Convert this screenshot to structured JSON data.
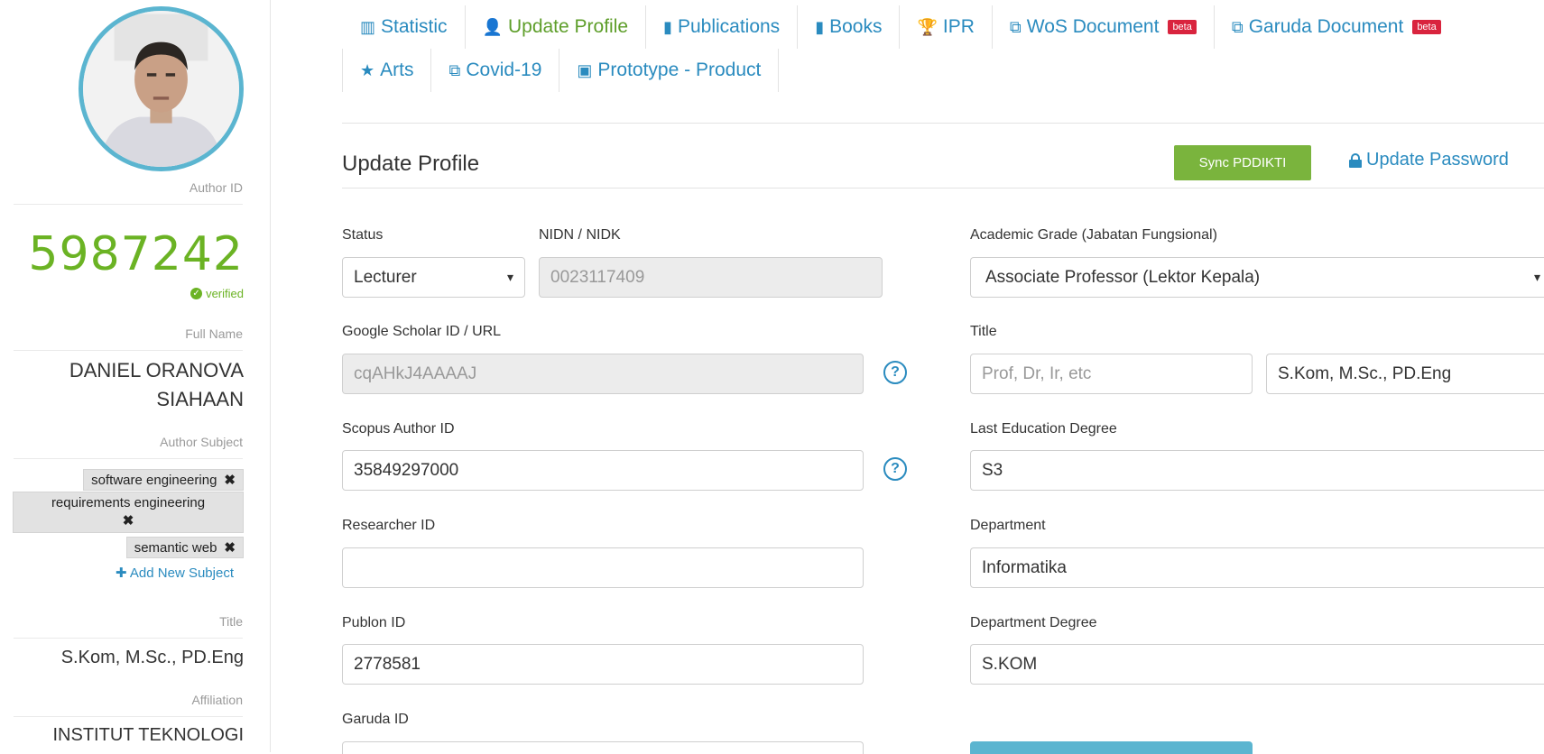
{
  "sidebar": {
    "author_id_label": "Author ID",
    "author_id": "5987242",
    "verified": "verified",
    "full_name_label": "Full Name",
    "full_name": "DANIEL ORANOVA SIAHAAN",
    "subject_label": "Author Subject",
    "subjects": [
      "software engineering",
      "requirements engineering",
      "semantic web"
    ],
    "add_subject": "Add New Subject",
    "title_label": "Title",
    "title": "S.Kom, M.Sc., PD.Eng",
    "affiliation_label": "Affiliation",
    "affiliation": "INSTITUT TEKNOLOGI"
  },
  "tabs": {
    "row1": [
      {
        "label": "Statistic",
        "icon": "bar-chart-icon"
      },
      {
        "label": "Update Profile",
        "icon": "user-icon"
      },
      {
        "label": "Publications",
        "icon": "book-icon"
      },
      {
        "label": "Books",
        "icon": "book-icon"
      },
      {
        "label": "IPR",
        "icon": "trophy-icon"
      },
      {
        "label": "WoS Document",
        "icon": "copy-icon",
        "badge": "beta"
      },
      {
        "label": "Garuda Document",
        "icon": "copy-icon",
        "badge": "beta"
      }
    ],
    "row2": [
      {
        "label": "Arts",
        "icon": "star-icon"
      },
      {
        "label": "Covid-19",
        "icon": "copy-icon"
      },
      {
        "label": "Prototype - Product",
        "icon": "frame-icon"
      }
    ]
  },
  "panel": {
    "title": "Update Profile",
    "sync_button": "Sync PDDIKTI",
    "update_password": "Update Password"
  },
  "form": {
    "status_label": "Status",
    "status_value": "Lecturer",
    "nidn_label": "NIDN / NIDK",
    "nidn_value": "0023117409",
    "academic_grade_label": "Academic Grade (Jabatan Fungsional)",
    "academic_grade_value": "Associate Professor (Lektor Kepala)",
    "scholar_label": "Google Scholar ID / URL",
    "scholar_value": "cqAHkJ4AAAAJ",
    "title_label": "Title",
    "title_front_placeholder": "Prof, Dr, Ir, etc",
    "title_back_value": "S.Kom, M.Sc., PD.Eng",
    "scopus_label": "Scopus Author ID",
    "scopus_value": "35849297000",
    "last_edu_label": "Last Education Degree",
    "last_edu_value": "S3",
    "researcher_label": "Researcher ID",
    "researcher_value": "",
    "department_label": "Department",
    "department_value": "Informatika",
    "publon_label": "Publon ID",
    "publon_value": "2778581",
    "department_degree_label": "Department Degree",
    "department_degree_value": "S.KOM",
    "garuda_label": "Garuda ID"
  }
}
